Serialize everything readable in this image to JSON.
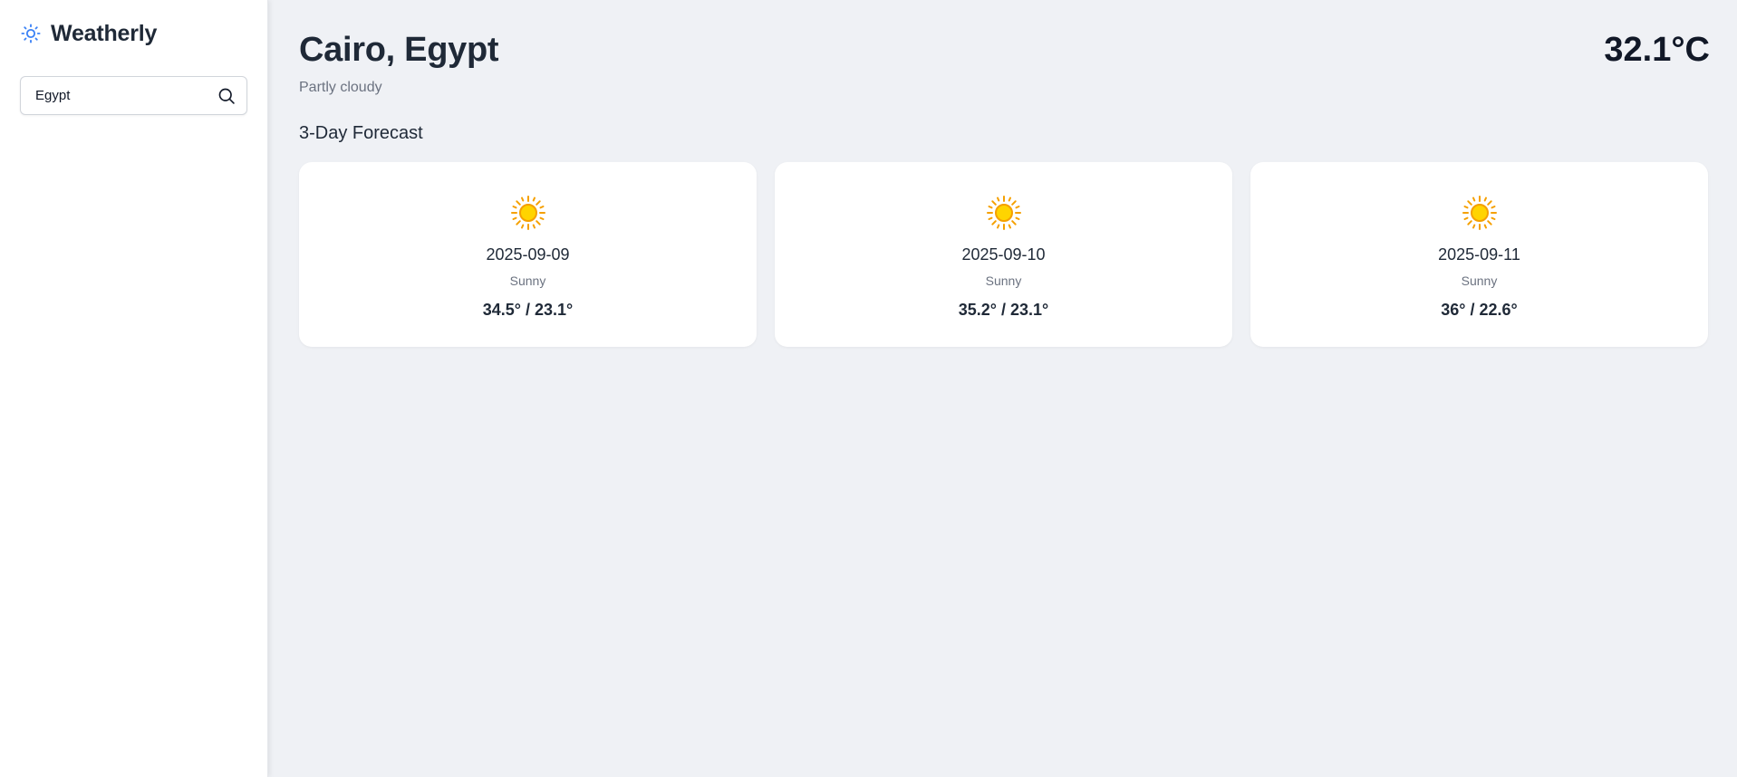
{
  "sidebar": {
    "brand_icon": "sun-icon",
    "brand_name": "Weatherly",
    "search": {
      "value": "Egypt",
      "icon": "search-icon"
    }
  },
  "main": {
    "city": "Cairo, Egypt",
    "condition": "Partly cloudy",
    "temperature": "32.1°C",
    "forecast_title": "3-Day Forecast",
    "forecast": [
      {
        "icon": "sun-icon",
        "date": "2025-09-09",
        "condition": "Sunny",
        "range": "34.5° / 23.1°"
      },
      {
        "icon": "sun-icon",
        "date": "2025-09-10",
        "condition": "Sunny",
        "range": "35.2° / 23.1°"
      },
      {
        "icon": "sun-icon",
        "date": "2025-09-11",
        "condition": "Sunny",
        "range": "36° / 22.6°"
      }
    ]
  },
  "colors": {
    "accent": "#3b82f6",
    "sun": "#ffd400",
    "sun_rays": "#f5a000"
  }
}
